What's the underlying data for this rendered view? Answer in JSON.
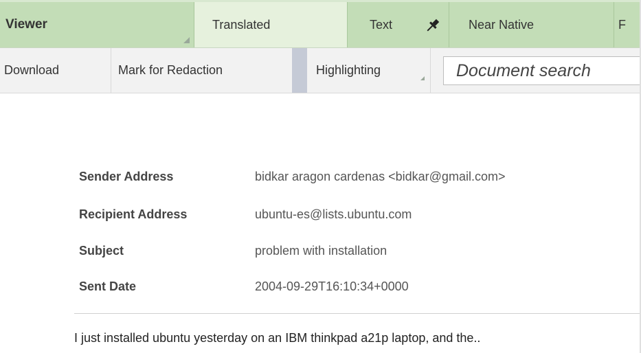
{
  "tabs": {
    "viewer_label": "Viewer",
    "translated_label": "Translated",
    "text_label": "Text",
    "near_native_label": "Near Native",
    "more_label": "F"
  },
  "toolbar": {
    "download_label": "Download",
    "redaction_label": "Mark for Redaction",
    "highlighting_label": "Highlighting",
    "search_placeholder": "Document search"
  },
  "metadata": {
    "sender_label": "Sender Address",
    "sender_value": "bidkar aragon cardenas <bidkar@gmail.com>",
    "recipient_label": "Recipient Address",
    "recipient_value": "ubuntu-es@lists.ubuntu.com",
    "subject_label": "Subject",
    "subject_value": "problem with installation",
    "date_label": "Sent Date",
    "date_value": "2004-09-29T16:10:34+0000"
  },
  "body": {
    "preview": "I just installed ubuntu yesterday on an IBM thinkpad a21p laptop, and the.."
  },
  "colors": {
    "tab_bar": "#c3ddb7",
    "active_tab": "#e6f1dd",
    "toolbar": "#f2f2f2",
    "separator": "#c5cad6"
  },
  "icons": {
    "pin": "pushpin-icon",
    "grip": "resize-grip-icon"
  }
}
